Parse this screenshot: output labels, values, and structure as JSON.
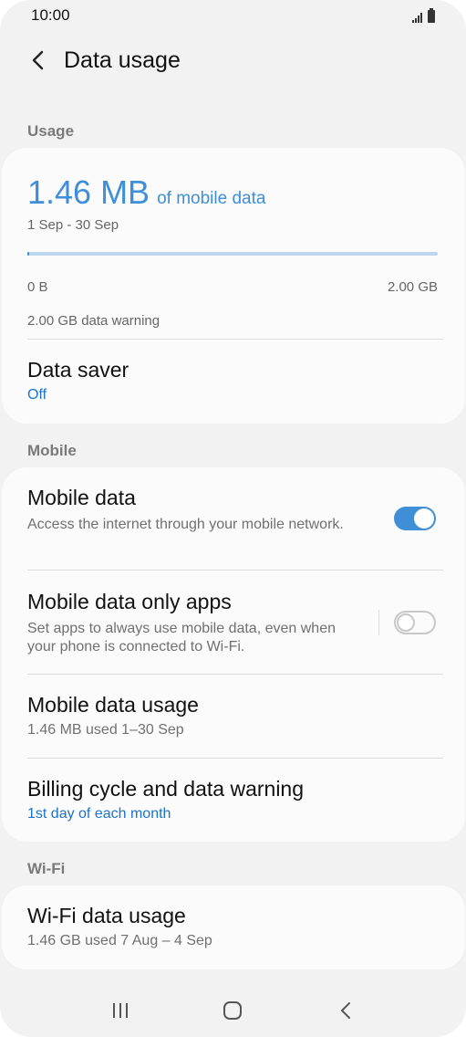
{
  "status_bar": {
    "time": "10:00"
  },
  "header": {
    "title": "Data usage"
  },
  "usage_section": {
    "label": "Usage",
    "amount": "1.46 MB",
    "amount_suffix": "of mobile data",
    "period": "1 Sep - 30 Sep",
    "progress_fraction": 0.0007,
    "range_min": "0 B",
    "range_max": "2.00 GB",
    "warning": "2.00 GB data warning",
    "data_saver": {
      "title": "Data saver",
      "value": "Off"
    }
  },
  "mobile_section": {
    "label": "Mobile",
    "mobile_data": {
      "title": "Mobile data",
      "description": "Access the internet through your mobile network.",
      "enabled": true
    },
    "mobile_data_only_apps": {
      "title": "Mobile data only apps",
      "description": "Set apps to always use mobile data, even when your phone is connected to Wi-Fi.",
      "enabled": false
    },
    "mobile_data_usage": {
      "title": "Mobile data usage",
      "description": "1.46 MB used 1–30 Sep"
    },
    "billing_cycle": {
      "title": "Billing cycle and data warning",
      "value": "1st day of each month"
    }
  },
  "wifi_section": {
    "label": "Wi-Fi",
    "wifi_data_usage": {
      "title": "Wi-Fi data usage",
      "description": "1.46 GB used 7 Aug – 4 Sep"
    }
  },
  "colors": {
    "accent": "#3e8ed8",
    "link_blue": "#1a73c8",
    "background": "#f2f2f2",
    "card": "#fbfbfb"
  },
  "icons": {
    "back": "back-arrow-icon",
    "recents": "recent-apps-icon",
    "home": "home-icon",
    "nav_back": "nav-back-icon"
  }
}
